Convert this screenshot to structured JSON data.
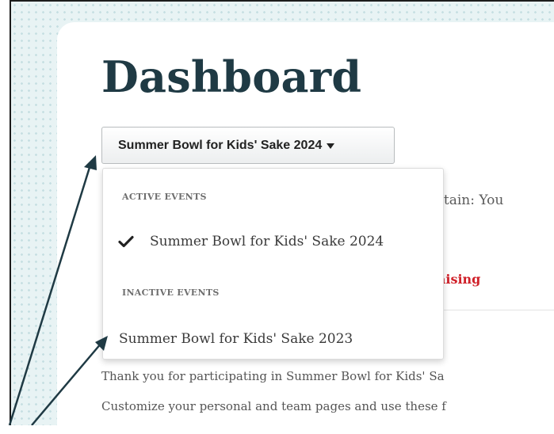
{
  "page": {
    "title": "Dashboard"
  },
  "event_selector": {
    "selected": "Summer Bowl for Kids' Sake 2024",
    "caret_icon": "caret-down-icon"
  },
  "dropdown": {
    "active_label": "ACTIVE EVENTS",
    "active_items": [
      {
        "label": "Summer Bowl for Kids' Sake 2024",
        "checked": true,
        "icon": "check-icon"
      }
    ],
    "inactive_label": "INACTIVE EVENTS",
    "inactive_items": [
      {
        "label": "Summer Bowl for Kids' Sake 2023",
        "checked": false
      }
    ]
  },
  "background_content": {
    "team_captain": "ptain: You",
    "fundraising": "aising",
    "thanks_line": "Thank you for participating in Summer Bowl for Kids' Sa",
    "customize_line": "Customize your personal and team pages and use these f"
  },
  "colors": {
    "title": "#1f3a44",
    "fundraising": "#d0212a",
    "annotation_arrow": "#1f3a44",
    "background_dots": "#c6dfe2"
  }
}
